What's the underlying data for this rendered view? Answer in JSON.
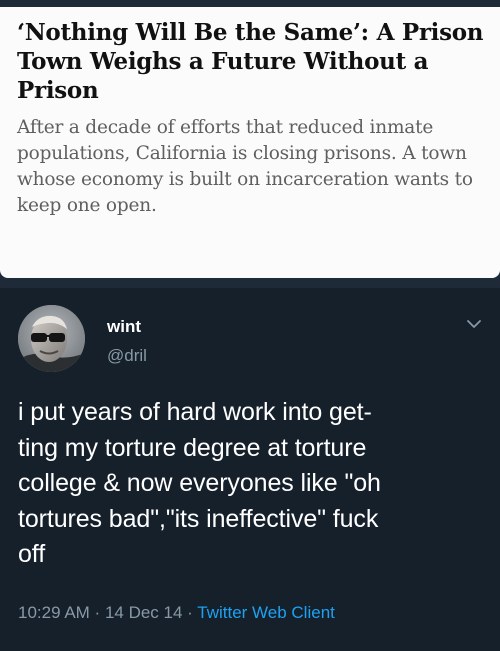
{
  "article": {
    "headline": "‘Nothing Will Be the Same’: A Prison Town Weighs a Future Without a Prison",
    "summary": "After a decade of efforts that reduced inmate populations, California is closing prisons. A town whose economy is built on incarceration wants to keep one open."
  },
  "tweet": {
    "display_name": "wint",
    "handle": "@dril",
    "text": "i put years of hard work into get-\nting my torture degree at torture\ncollege & now everyones like \"oh\ntortures bad\",\"its ineffective\" fuck\noff",
    "time": "10:29 AM",
    "separator": " · ",
    "date": "14 Dec 14",
    "client": "Twitter Web Client",
    "menu_icon": "chevron-down-icon",
    "avatar_icon": "avatar"
  },
  "colors": {
    "page_background": "#1f2a38",
    "tweet_background": "#15202b",
    "article_background": "#fbfbfb",
    "secondary_text": "#8899a6",
    "link": "#1da1f2"
  }
}
